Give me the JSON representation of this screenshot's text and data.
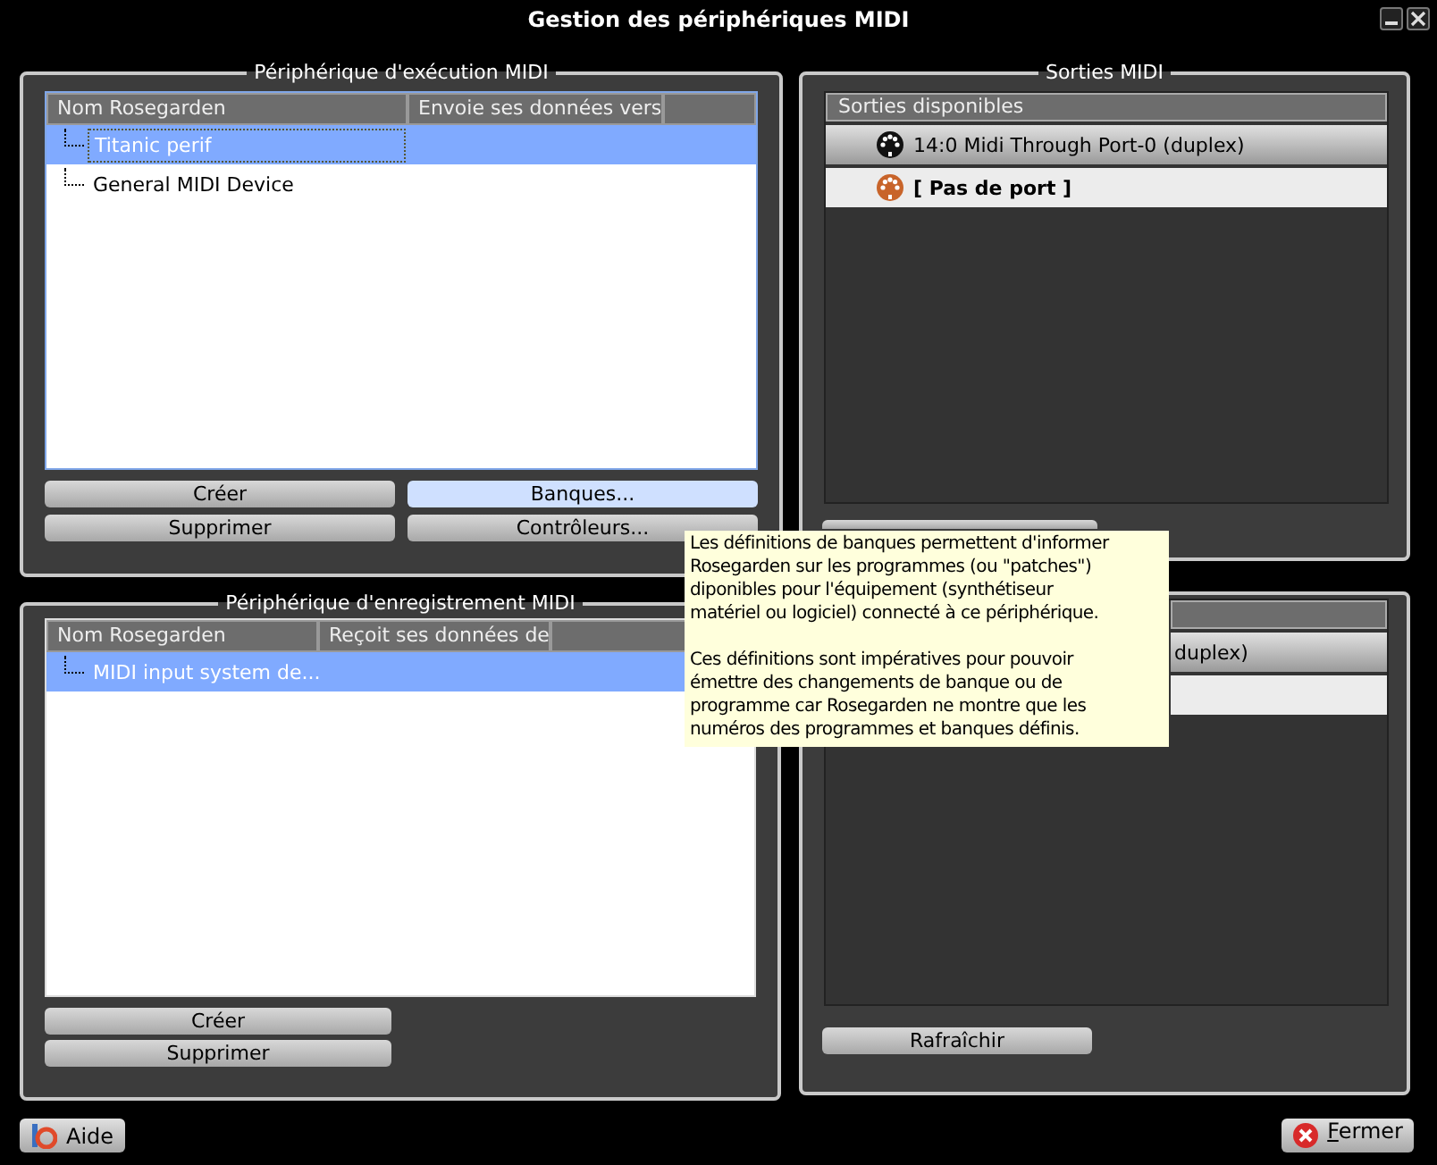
{
  "window": {
    "title": "Gestion des périphériques MIDI"
  },
  "playback_panel": {
    "title": "Périphérique d'exécution MIDI",
    "columns": [
      "Nom Rosegarden",
      "Envoie ses données vers"
    ],
    "rows": [
      {
        "name": "Titanic perif",
        "selected": true
      },
      {
        "name": "General MIDI Device",
        "selected": false
      }
    ],
    "buttons": [
      {
        "label": "Créer",
        "hovered": false
      },
      {
        "label": "Banques...",
        "hovered": true
      },
      {
        "label": "Supprimer",
        "hovered": false
      },
      {
        "label": "Contrôleurs...",
        "hovered": false
      }
    ]
  },
  "outputs_panel": {
    "title": "Sorties MIDI",
    "header": "Sorties disponibles",
    "ports": [
      {
        "label": "14:0 Midi Through Port-0 (duplex)",
        "kind": "port",
        "selected": false
      },
      {
        "label": "[ Pas de port ]",
        "kind": "none",
        "selected": true
      }
    ]
  },
  "record_panel": {
    "title": "Périphérique d'enregistrement MIDI",
    "columns": [
      "Nom Rosegarden",
      "Reçoit ses données de"
    ],
    "rows": [
      {
        "name": "MIDI input system de...",
        "selected": true
      }
    ],
    "buttons": [
      {
        "label": "Créer",
        "hovered": false
      },
      {
        "label": "Supprimer",
        "hovered": false
      }
    ]
  },
  "inputs_panel": {
    "ports": [
      {
        "label": "duplex)",
        "selected": false
      },
      {
        "selected": true
      }
    ],
    "refresh_button": "Rafraîchir"
  },
  "tooltip": {
    "paragraphs": [
      "Les définitions de banques permettent d'informer\nRosegarden sur les programmes (ou \"patches\")\ndiponibles pour l'équipement (synthétiseur\nmatériel ou logiciel) connecté à ce périphérique.",
      "Ces définitions sont impératives pour pouvoir\némettre des changements de banque ou de\nprogramme car Rosegarden ne montre que les\nnuméros des programmes et banques définis."
    ]
  },
  "footer": {
    "help_button": "Aide",
    "close_button": "Fermer"
  }
}
